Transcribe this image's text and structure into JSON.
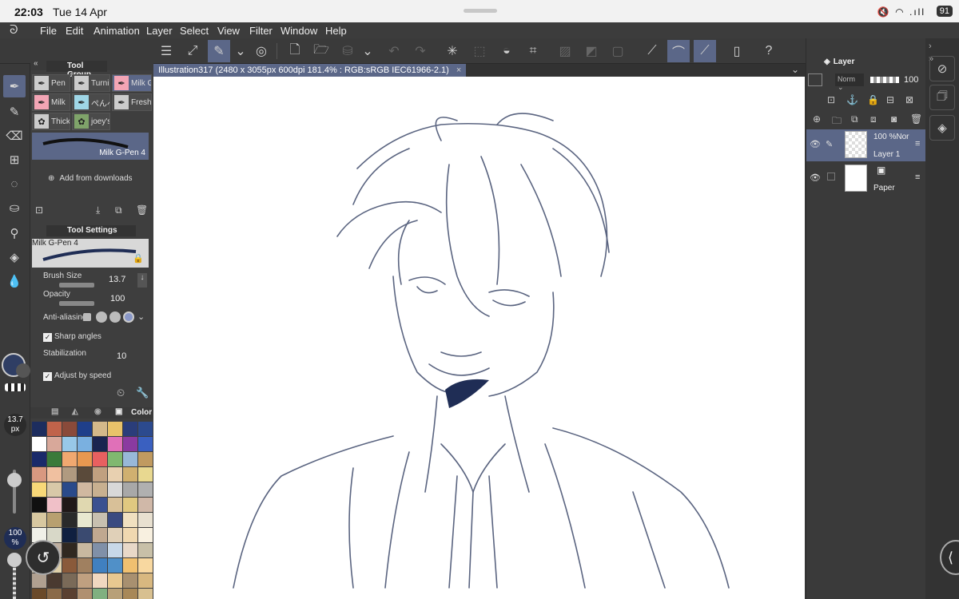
{
  "status_bar": {
    "time": "22:03",
    "date": "Tue 14 Apr",
    "battery": "91",
    "icons": "🔇 ◠ .ıll"
  },
  "menu": [
    "File",
    "Edit",
    "Animation",
    "Layer",
    "Select",
    "View",
    "Filter",
    "Window",
    "Help"
  ],
  "document": {
    "tab_title": "Illustration317 (2480 x 3055px 600dpi 181.4% : RGB:sRGB IEC61966-2.1)",
    "close": "×"
  },
  "tool_group": {
    "title": "Tool Group",
    "brushes": [
      {
        "label": "Pen",
        "icon": "pen-icon",
        "style": "plain"
      },
      {
        "label": "Turnip",
        "icon": "pen-icon",
        "style": "plain"
      },
      {
        "label": "Milk G",
        "icon": "pen-icon",
        "style": "pink"
      },
      {
        "label": "Milk",
        "icon": "pen-icon",
        "style": "pink"
      },
      {
        "label": "ぺんぺ",
        "icon": "pen-icon",
        "style": "blue"
      },
      {
        "label": "Fresh",
        "icon": "pen-icon",
        "style": "plain"
      },
      {
        "label": "Thick",
        "icon": "brush-icon",
        "style": "plain"
      },
      {
        "label": "joey's",
        "icon": "brush-icon",
        "style": "green"
      }
    ],
    "selected_preview": "Milk G-Pen 4",
    "add_from_downloads": "Add from downloads"
  },
  "tool_settings": {
    "title": "Tool Settings",
    "brush_name": "Milk G-Pen 4",
    "brush_size_label": "Brush Size",
    "brush_size": "13.7",
    "opacity_label": "Opacity",
    "opacity": "100",
    "anti_aliasing_label": "Anti-aliasing",
    "sharp_angles": "Sharp angles",
    "stabilization_label": "Stabilization",
    "stabilization": "10",
    "adjust_by_speed": "Adjust by speed"
  },
  "color_panel": {
    "tab_label": "Color",
    "swatches": [
      "#1d2d5e",
      "#c0634a",
      "#8a4a3a",
      "#1f3f8a",
      "#d4b98a",
      "#e8c26a",
      "#2a3d7a",
      "#2c4a8e",
      "#ffffff",
      "#d8a89a",
      "#98c8e8",
      "#7ab0e0",
      "#1a2450",
      "#e070b8",
      "#8a3aa0",
      "#3a60c0",
      "#1a2a6a",
      "#3a7a3a",
      "#f0a870",
      "#e89850",
      "#e86060",
      "#80b870",
      "#98b8d8",
      "#c09a60",
      "#d89880",
      "#f0c0a0",
      "#b09a80",
      "#5a4a3a",
      "#c0a080",
      "#e8d0b0",
      "#d0b070",
      "#e8d890",
      "#f8d878",
      "#d8c8a8",
      "#2a4a8a",
      "#d0b8a0",
      "#c8b090",
      "#d8d8d8",
      "#a8a8a8",
      "#b0b0b0",
      "#101010",
      "#f0c0c8",
      "#201818",
      "#e0d8b0",
      "#3a5090",
      "#d8c098",
      "#e0c880",
      "#d0b8a8",
      "#d8c8a0",
      "#b8a070",
      "#2a2a2a",
      "#e8e8d0",
      "#c8c0b0",
      "#3a4a80",
      "#f0e0c0",
      "#e8e0d0",
      "#f0f0e8",
      "#d8d8c8",
      "#102040",
      "#3a4a70",
      "#c0a890",
      "#e0d0b8",
      "#f0d8b0",
      "#f8f0e0",
      "#d8d0c0",
      "#c0b0a0",
      "#302820",
      "#c8b8a0",
      "#8090a8",
      "#c8d8e8",
      "#e8d8c8",
      "#c8c0a8",
      "#c8c0a8",
      "#e0d0a8",
      "#8a5a3a",
      "#a08060",
      "#4080c0",
      "#5090c8",
      "#f0c070",
      "#f8d8a0",
      "#b0a090",
      "#4a3a30",
      "#7a6a58",
      "#c0a080",
      "#f0d8c0",
      "#e8c890",
      "#a89070",
      "#d8b880",
      "#6a4a2a",
      "#8a6a48",
      "#5a4030",
      "#b09070",
      "#80b080",
      "#b8a078",
      "#a88858",
      "#d8c090",
      "#5a3a1a",
      "#7a5a38",
      "#9a7a58",
      "#d8c8b0",
      "#e0d8c8",
      "#c8b898",
      "#a89878",
      "#e8d8b0"
    ]
  },
  "left_tools": {
    "brush_size_badge": "13.7",
    "brush_size_unit": "px",
    "opacity_badge": "100",
    "opacity_unit": "%"
  },
  "layer_panel": {
    "title": "Layer",
    "blend_mode": "Norm",
    "opacity": "100",
    "layers": [
      {
        "mode": "100 %Nor",
        "name": "Layer 1",
        "selected": true
      },
      {
        "mode": "",
        "name": "Paper",
        "selected": false
      }
    ]
  }
}
